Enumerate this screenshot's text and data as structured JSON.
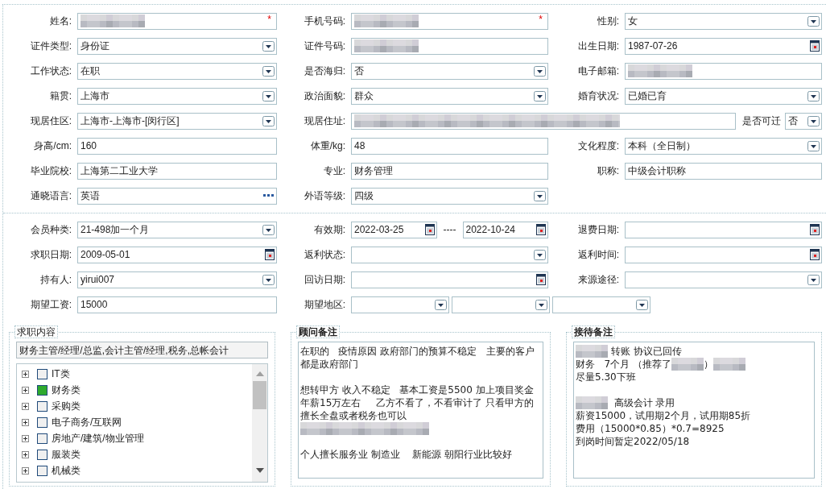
{
  "sections": [
    {
      "rows": [
        {
          "cells": [
            {
              "label": "姓名:",
              "fields": [
                {
                  "kind": "text",
                  "redacted": true,
                  "required_mark": "*"
                }
              ]
            },
            {
              "label": "手机号码:",
              "fields": [
                {
                  "kind": "text",
                  "redacted": true,
                  "required_mark": "*"
                }
              ]
            },
            {
              "label": "性别:",
              "fields": [
                {
                  "kind": "select",
                  "value": "女"
                }
              ]
            }
          ]
        },
        {
          "cells": [
            {
              "label": "证件类型:",
              "fields": [
                {
                  "kind": "select",
                  "value": "身份证"
                }
              ]
            },
            {
              "label": "证件号码:",
              "fields": [
                {
                  "kind": "text",
                  "redacted": true
                }
              ]
            },
            {
              "label": "出生日期:",
              "fields": [
                {
                  "kind": "date",
                  "value": "1987-07-26"
                }
              ]
            }
          ]
        },
        {
          "cells": [
            {
              "label": "工作状态:",
              "fields": [
                {
                  "kind": "select",
                  "value": "在职"
                }
              ]
            },
            {
              "label": "是否海归:",
              "fields": [
                {
                  "kind": "select",
                  "value": "否"
                }
              ]
            },
            {
              "label": "电子邮箱:",
              "fields": [
                {
                  "kind": "text",
                  "redacted": true
                }
              ]
            }
          ]
        },
        {
          "cells": [
            {
              "label": "籍贯:",
              "fields": [
                {
                  "kind": "select",
                  "value": "上海市"
                }
              ]
            },
            {
              "label": "政治面貌:",
              "fields": [
                {
                  "kind": "select",
                  "value": "群众"
                }
              ]
            },
            {
              "label": "婚育状况:",
              "fields": [
                {
                  "kind": "select",
                  "value": "已婚已育"
                }
              ]
            }
          ]
        },
        {
          "cells": [
            {
              "label": "现居住区:",
              "fields": [
                {
                  "kind": "select",
                  "value": " 上海市-上海市-[闵行区]"
                }
              ]
            },
            {
              "label": "现居住址:",
              "fields": [
                {
                  "kind": "text",
                  "redacted": true
                },
                {
                  "kind": "label",
                  "text": "是否可迁"
                },
                {
                  "kind": "select",
                  "value": "否"
                }
              ]
            }
          ]
        },
        {
          "cells": [
            {
              "label": "身高/cm:",
              "fields": [
                {
                  "kind": "text",
                  "value": "160"
                }
              ]
            },
            {
              "label": "体重/kg:",
              "fields": [
                {
                  "kind": "text",
                  "value": "48"
                }
              ]
            },
            {
              "label": "文化程度:",
              "fields": [
                {
                  "kind": "select",
                  "value": "本科（全日制）"
                }
              ]
            }
          ]
        },
        {
          "cells": [
            {
              "label": "毕业院校:",
              "fields": [
                {
                  "kind": "text",
                  "value": "上海第二工业大学"
                }
              ]
            },
            {
              "label": "专业:",
              "fields": [
                {
                  "kind": "text",
                  "value": "财务管理"
                }
              ]
            },
            {
              "label": "职称:",
              "fields": [
                {
                  "kind": "text",
                  "value": "中级会计职称"
                }
              ]
            }
          ]
        },
        {
          "cells": [
            {
              "label": "通晓语言:",
              "fields": [
                {
                  "kind": "lookup",
                  "value": "英语"
                }
              ]
            },
            {
              "label": "外语等级:",
              "fields": [
                {
                  "kind": "select",
                  "value": "四级"
                }
              ]
            }
          ]
        }
      ]
    },
    {
      "rows": [
        {
          "cells": [
            {
              "label": "会员种类:",
              "fields": [
                {
                  "kind": "select",
                  "value": " 21-498加一个月"
                }
              ]
            },
            {
              "label": "有效期:",
              "fields": [
                {
                  "kind": "date",
                  "value": "2022-03-25"
                },
                {
                  "kind": "separator",
                  "text": "----"
                },
                {
                  "kind": "date",
                  "value": "2022-10-24"
                }
              ]
            },
            {
              "label": "退费日期:",
              "fields": [
                {
                  "kind": "date"
                }
              ]
            }
          ]
        },
        {
          "cells": [
            {
              "label": "求职日期:",
              "fields": [
                {
                  "kind": "date",
                  "value": "2009-05-01"
                }
              ]
            },
            {
              "label": "返利状态:",
              "fields": [
                {
                  "kind": "select"
                }
              ]
            },
            {
              "label": "返利时间:",
              "fields": [
                {
                  "kind": "date"
                }
              ]
            }
          ]
        },
        {
          "cells": [
            {
              "label": "持有人:",
              "fields": [
                {
                  "kind": "select",
                  "value": "yirui007"
                }
              ]
            },
            {
              "label": "回访日期:",
              "fields": [
                {
                  "kind": "date"
                }
              ]
            },
            {
              "label": "来源途径:",
              "fields": [
                {
                  "kind": "select"
                }
              ]
            }
          ]
        },
        {
          "cells": [
            {
              "label": "期望工资:",
              "fields": [
                {
                  "kind": "text",
                  "value": "15000"
                }
              ]
            },
            {
              "label": "期望地区:",
              "fields": [
                {
                  "kind": "select"
                },
                {
                  "kind": "select"
                },
                {
                  "kind": "select"
                }
              ]
            }
          ]
        }
      ]
    }
  ],
  "job_intent": {
    "title": "求职内容",
    "bold": false,
    "summary": "财务主管/经理/总监,会计主管/经理,税务,总帐会计",
    "tree": [
      {
        "label": "IT类",
        "checked": false
      },
      {
        "label": "财务类",
        "checked": true
      },
      {
        "label": "采购类",
        "checked": false
      },
      {
        "label": "电子商务/互联网",
        "checked": false
      },
      {
        "label": "房地产/建筑/物业管理",
        "checked": false
      },
      {
        "label": "服装类",
        "checked": false
      },
      {
        "label": "机械类",
        "checked": false
      }
    ]
  },
  "notes": [
    {
      "title": "顾问备注",
      "bold": true,
      "lines": [
        {
          "kind": "line",
          "parts": [
            {
              "kind": "text",
              "text": "在职的   疫情原因 政府部门的预算不稳定   主要的客户"
            }
          ]
        },
        {
          "kind": "line",
          "parts": [
            {
              "kind": "text",
              "text": "都是政府部门"
            }
          ]
        },
        {
          "kind": "blank"
        },
        {
          "kind": "line",
          "parts": [
            {
              "kind": "text",
              "text": "想转甲方 收入不稳定   基本工资是5500 加上项目奖金"
            }
          ]
        },
        {
          "kind": "line",
          "parts": [
            {
              "kind": "text",
              "text": "年薪15万左右     乙方不看了，不看审计了 只看甲方的"
            }
          ]
        },
        {
          "kind": "line",
          "parts": [
            {
              "kind": "text",
              "text": "擅长全盘或者税务也可以"
            }
          ]
        },
        {
          "kind": "line",
          "parts": [
            {
              "kind": "mosaic"
            }
          ]
        },
        {
          "kind": "blank"
        },
        {
          "kind": "line",
          "parts": [
            {
              "kind": "text",
              "text": "个人擅长服务业 制造业    新能源 朝阳行业比较好"
            }
          ]
        }
      ]
    },
    {
      "title": "接待备注",
      "bold": true,
      "lines": [
        {
          "kind": "line",
          "parts": [
            {
              "kind": "mosaic"
            },
            {
              "kind": "text",
              "text": " 转账 协议已回传"
            }
          ]
        },
        {
          "kind": "line",
          "parts": [
            {
              "kind": "text",
              "text": "财务   7个月 （推荐了"
            },
            {
              "kind": "mosaic"
            },
            {
              "kind": "text",
              "text": "）"
            },
            {
              "kind": "mosaic"
            }
          ]
        },
        {
          "kind": "line",
          "parts": [
            {
              "kind": "text",
              "text": "尽量5.30下班"
            }
          ]
        },
        {
          "kind": "blank"
        },
        {
          "kind": "line",
          "parts": [
            {
              "kind": "mosaic"
            },
            {
              "kind": "text",
              "text": "  高级会计 录用"
            }
          ]
        },
        {
          "kind": "line",
          "parts": [
            {
              "kind": "text",
              "text": "薪资15000，试用期2个月，试用期85折"
            }
          ]
        },
        {
          "kind": "line",
          "parts": [
            {
              "kind": "text",
              "text": "费用（15000*0.85）*0.7=8925"
            }
          ]
        },
        {
          "kind": "line",
          "parts": [
            {
              "kind": "text",
              "text": "到岗时间暂定2022/05/18"
            }
          ]
        }
      ]
    }
  ]
}
